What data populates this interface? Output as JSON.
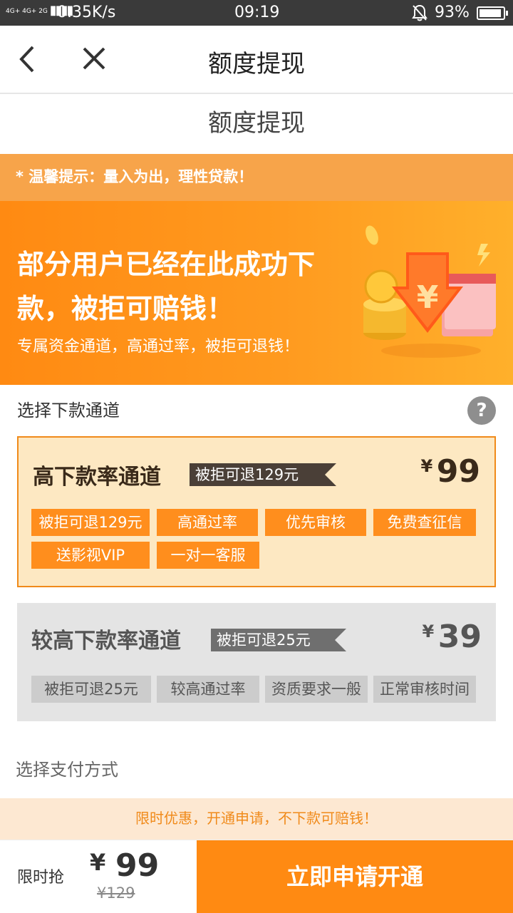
{
  "status_bar": {
    "signal": "4G+ 4G+ 2G",
    "speed": "0.35K/s",
    "time": "09:19",
    "battery": "93%"
  },
  "nav": {
    "title": "额度提现"
  },
  "page": {
    "subtitle": "额度提现"
  },
  "tip": {
    "text": "* 温馨提示：量入为出，理性贷款！"
  },
  "banner": {
    "headline": "部分用户已经在此成功下款，被拒可赔钱！",
    "subline": "专属资金通道，高通过率，被拒可退钱！"
  },
  "channels": {
    "section_title": "选择下款通道",
    "help": "?",
    "items": [
      {
        "name": "高下款率通道",
        "flag": "被拒可退129元",
        "currency": "¥",
        "price": "99",
        "tags": [
          "被拒可退129元",
          "高通过率",
          "优先审核",
          "免费查征信",
          "送影视VIP",
          "一对一客服"
        ]
      },
      {
        "name": "较高下款率通道",
        "flag": "被拒可退25元",
        "currency": "¥",
        "price": "39",
        "tags": [
          "被拒可退25元",
          "较高通过率",
          "资质要求一般",
          "正常审核时间"
        ]
      }
    ]
  },
  "payment": {
    "section_title": "选择支付方式"
  },
  "promo": {
    "text": "限时优惠，开通申请，不下款可赔钱！"
  },
  "footer": {
    "label": "限时抢",
    "currency": "¥",
    "price": "99",
    "original": "¥129",
    "cta": "立即申请开通"
  },
  "colors": {
    "brand_orange": "#ff8a12",
    "selected_card_bg": "#fde8c2",
    "unselected_card_bg": "#e4e4e4"
  }
}
